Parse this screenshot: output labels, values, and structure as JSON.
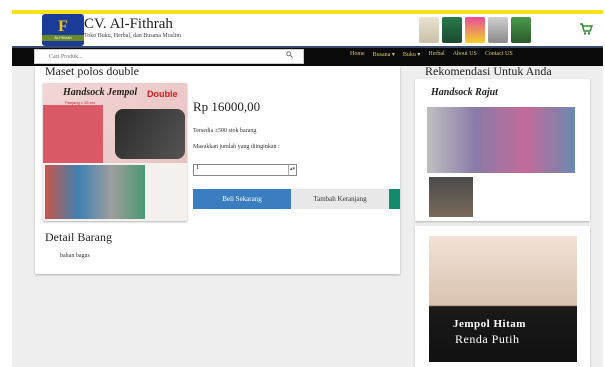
{
  "brand": {
    "logo_letter": "F",
    "logo_sub": "Al-Fithrah",
    "title": "CV. Al-Fithrah",
    "subtitle": "Toko Buku, Herbal, dan Busana Muslim"
  },
  "search": {
    "placeholder": "Cari Produk..."
  },
  "nav": {
    "items": [
      "Home",
      "Busana ▾",
      "Buku ▾",
      "Herbal",
      "About US",
      "Contact US"
    ]
  },
  "product": {
    "title": "Maset polos double",
    "image_heading": "Handsock Jempol",
    "image_heading_accent": "Double",
    "image_size": "Panjang ± 25 cm",
    "price": "Rp 16000,00",
    "stock_text": "Tersedia ±500 stok barang",
    "qty_label": "Masukkan jumlah yang diinginkan :",
    "qty_value": "1",
    "buy_label": "Beli Sekarang",
    "cart_label": "Tambah Keranjang"
  },
  "detail": {
    "title": "Detail Barang",
    "body": "bahan bagus"
  },
  "recommend": {
    "title": "Rekomendasi Untuk Anda",
    "card1_heading": "Handsock Rajut",
    "card2_line1": "Jempol Hitam",
    "card2_line2": "Renda Putih"
  },
  "colors": {
    "accent_yellow": "#f5e21c",
    "nav_bg": "#0a0a0a",
    "buy_blue": "#3a7dc0",
    "teal": "#138a6e",
    "logo_blue": "#1c3c9a"
  }
}
